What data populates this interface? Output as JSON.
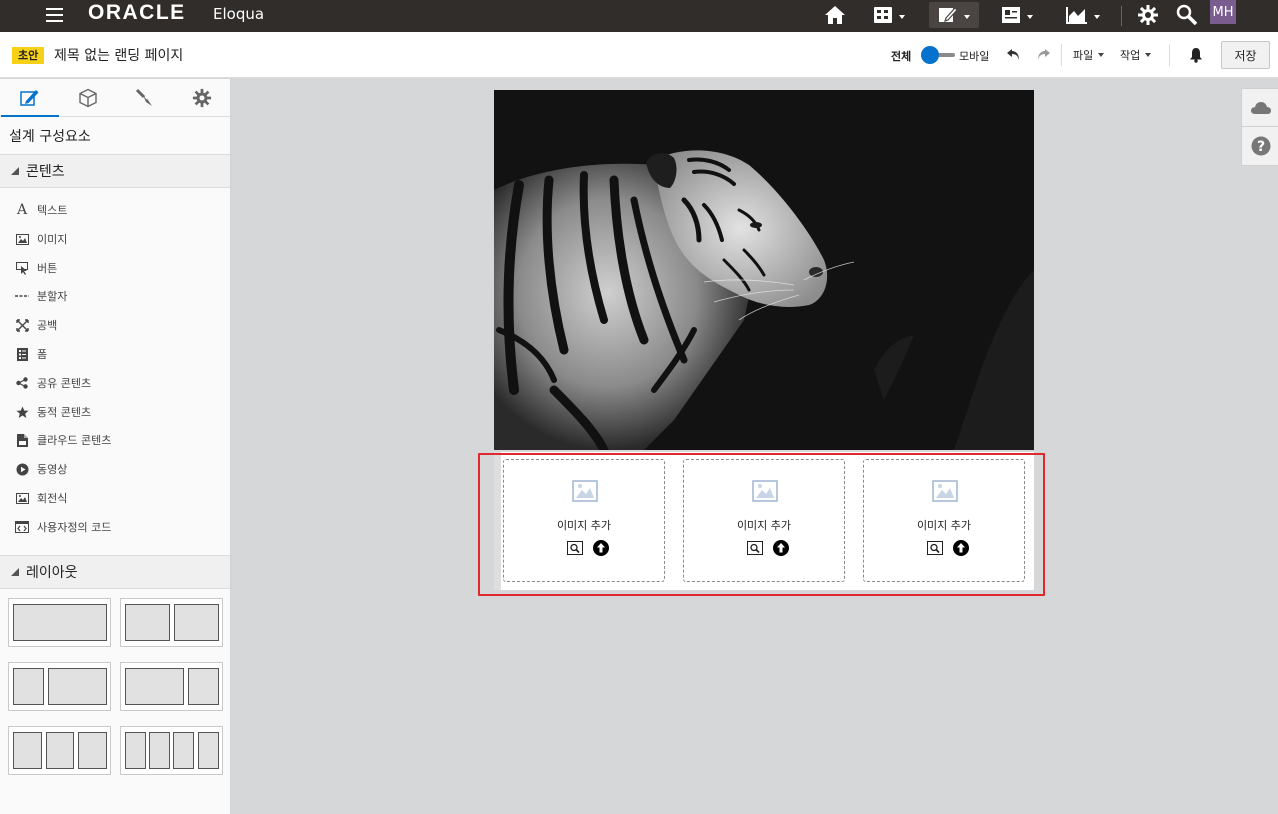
{
  "topbar": {
    "logo": "ORACLE",
    "product": "Eloqua",
    "avatar_initials": "MH",
    "avatar_color": "#7a5c8e",
    "icons": [
      "hamburger-icon",
      "home-icon",
      "apps-icon",
      "pencil-icon",
      "contacts-icon",
      "chart-icon",
      "gear-icon",
      "search-icon"
    ]
  },
  "subbar": {
    "draft_badge": "초안",
    "page_title": "제목 없는 랜딩 페이지",
    "toggle_all": "전체",
    "toggle_mobile": "모바일",
    "file_menu": "파일",
    "action_menu": "작업",
    "save_label": "저장"
  },
  "left_panel": {
    "title": "설계 구성요소",
    "content_section": "콘텐츠",
    "components": [
      {
        "label": "텍스트",
        "icon": "text-icon"
      },
      {
        "label": "이미지",
        "icon": "image-icon"
      },
      {
        "label": "버튼",
        "icon": "button-icon"
      },
      {
        "label": "분할자",
        "icon": "divider-icon"
      },
      {
        "label": "공백",
        "icon": "spacer-icon"
      },
      {
        "label": "폼",
        "icon": "form-icon"
      },
      {
        "label": "공유 콘텐츠",
        "icon": "share-icon"
      },
      {
        "label": "동적 콘텐츠",
        "icon": "star-icon"
      },
      {
        "label": "클라우드 콘텐츠",
        "icon": "cloud-content-icon"
      },
      {
        "label": "동영상",
        "icon": "video-icon"
      },
      {
        "label": "회전식",
        "icon": "carousel-icon"
      },
      {
        "label": "사용자정의 코드",
        "icon": "code-icon"
      }
    ],
    "layout_section": "레이아웃",
    "layouts": [
      "1-column",
      "2-column",
      "1-3-split",
      "3-1-split",
      "3-column",
      "4-column"
    ]
  },
  "canvas": {
    "image_slots": [
      {
        "label": "이미지 추가"
      },
      {
        "label": "이미지 추가"
      },
      {
        "label": "이미지 추가"
      }
    ],
    "selection_color": "#e0282f"
  },
  "colors": {
    "accent": "#0572ce",
    "topbar": "#312d2a",
    "badge": "#f7d117"
  }
}
